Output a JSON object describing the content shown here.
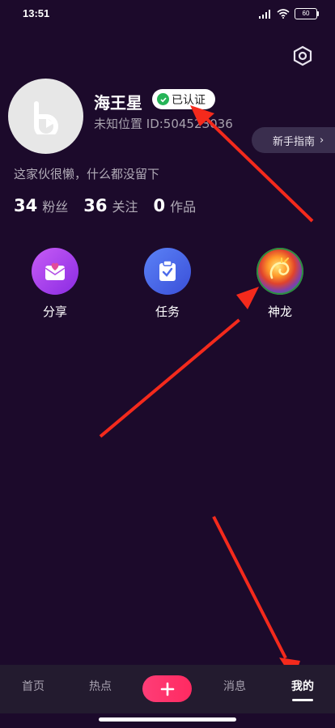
{
  "status_bar": {
    "time": "13:51",
    "battery": "60"
  },
  "profile": {
    "username": "海王星",
    "verified_label": "已认证",
    "location_id": "未知位置 ID:50452З036",
    "bio": "这家伙很懒，什么都没留下"
  },
  "guide": {
    "label": "新手指南",
    "chevron": "›"
  },
  "stats": [
    {
      "num": "34",
      "label": "粉丝"
    },
    {
      "num": "36",
      "label": "关注"
    },
    {
      "num": "0",
      "label": "作品"
    }
  ],
  "grid": [
    {
      "label": "分享",
      "icon": "mail-heart-icon"
    },
    {
      "label": "任务",
      "icon": "clipboard-check-icon"
    },
    {
      "label": "神龙",
      "icon": "dragon-icon"
    }
  ],
  "bottom_nav": {
    "items": [
      "首页",
      "热点",
      "消息",
      "我的"
    ],
    "active": "我的",
    "add_icon": "plus-icon"
  },
  "colors": {
    "background": "#1c0a2b",
    "accent": "#fe3d77",
    "arrow": "#f42a1c"
  }
}
